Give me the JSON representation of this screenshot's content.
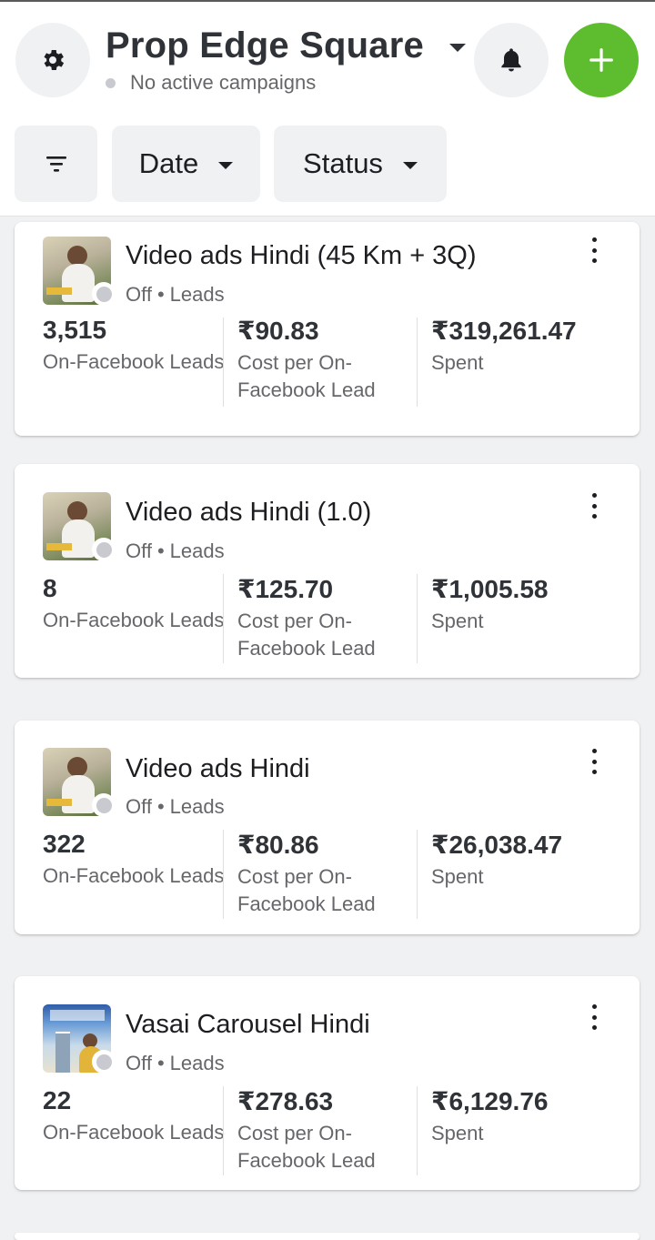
{
  "header": {
    "account_title": "Prop Edge Square",
    "subtitle": "No active campaigns",
    "settings_icon": "gear-icon",
    "notifications_icon": "bell-icon",
    "create_icon": "plus-icon",
    "accent_color": "#5ebd2e"
  },
  "filters": {
    "filter_icon": "filter-icon",
    "date_label": "Date",
    "status_label": "Status"
  },
  "campaigns": [
    {
      "name": "Video ads Hindi (45 Km + 3Q)",
      "status": "Off",
      "objective": "Leads",
      "results_value": "3,515",
      "results_label": "On-Facebook Leads",
      "cost_value": "₹90.83",
      "cost_label": "Cost per On-Facebook Lead",
      "spent_value": "₹319,261.47",
      "spent_label": "Spent"
    },
    {
      "name": "Video ads Hindi (1.0)",
      "status": "Off",
      "objective": "Leads",
      "results_value": "8",
      "results_label": "On-Facebook Leads",
      "cost_value": "₹125.70",
      "cost_label": "Cost per On-Facebook Lead",
      "spent_value": "₹1,005.58",
      "spent_label": "Spent"
    },
    {
      "name": "Video ads Hindi",
      "status": "Off",
      "objective": "Leads",
      "results_value": "322",
      "results_label": "On-Facebook Leads",
      "cost_value": "₹80.86",
      "cost_label": "Cost per On-Facebook Lead",
      "spent_value": "₹26,038.47",
      "spent_label": "Spent"
    },
    {
      "name": "Vasai Carousel Hindi",
      "status": "Off",
      "objective": "Leads",
      "results_value": "22",
      "results_label": "On-Facebook Leads",
      "cost_value": "₹278.63",
      "cost_label": "Cost per On-Facebook Lead",
      "spent_value": "₹6,129.76",
      "spent_label": "Spent"
    }
  ]
}
